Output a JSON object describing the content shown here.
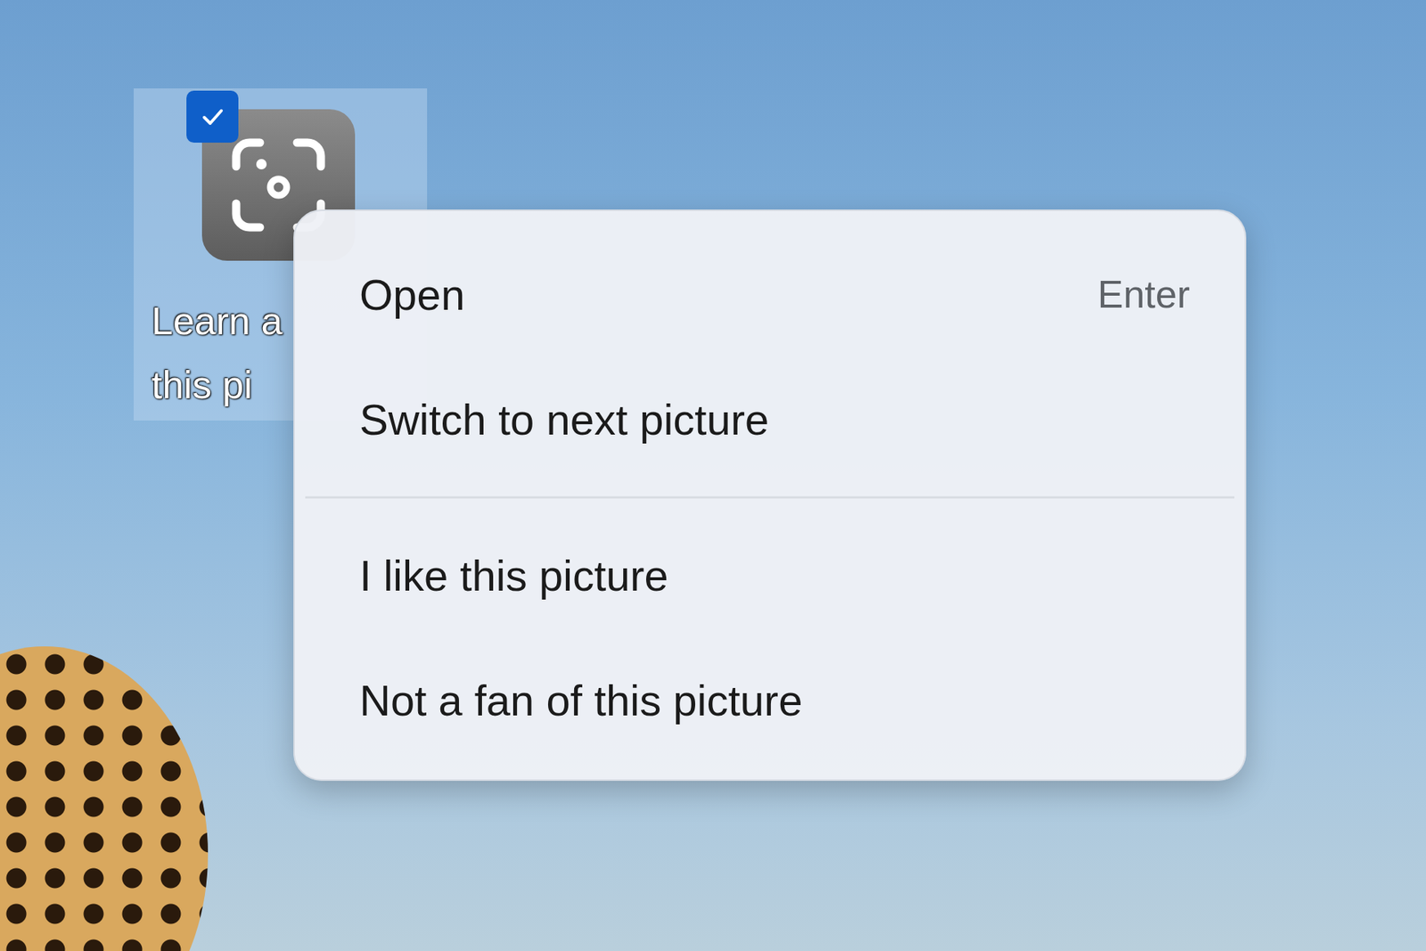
{
  "desktop_icon": {
    "label_lines": [
      "Learn a",
      "this pi"
    ],
    "selected": true,
    "checked": true
  },
  "context_menu": {
    "groups": [
      [
        {
          "label": "Open",
          "shortcut": "Enter"
        },
        {
          "label": "Switch to next picture",
          "shortcut": ""
        }
      ],
      [
        {
          "label": "I like this picture",
          "shortcut": ""
        },
        {
          "label": "Not a fan of this picture",
          "shortcut": ""
        }
      ]
    ]
  }
}
